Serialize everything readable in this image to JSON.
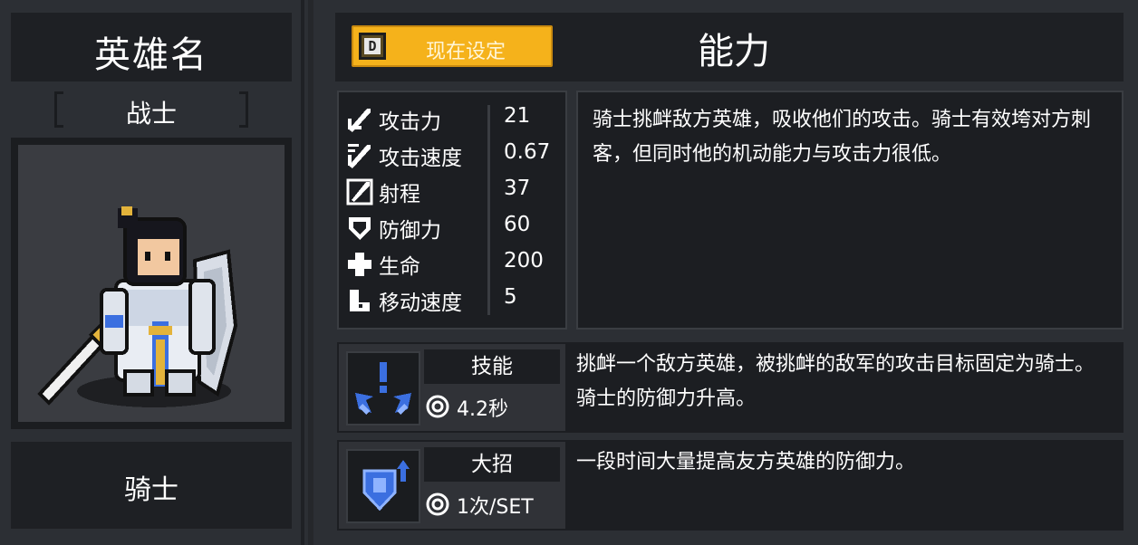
{
  "left": {
    "title": "英雄名",
    "class_label": "战士",
    "hero_name": "骑士"
  },
  "header": {
    "set_key": "D",
    "set_button": "现在设定",
    "title": "能力"
  },
  "stats": [
    {
      "icon": "sword-icon",
      "name": "攻击力",
      "value": "21"
    },
    {
      "icon": "attack-speed-icon",
      "name": "攻击速度",
      "value": "0.67"
    },
    {
      "icon": "range-icon",
      "name": "射程",
      "value": "37"
    },
    {
      "icon": "shield-icon",
      "name": "防御力",
      "value": "60"
    },
    {
      "icon": "health-cross-icon",
      "name": "生命",
      "value": "200"
    },
    {
      "icon": "boot-icon",
      "name": "移动速度",
      "value": "5"
    }
  ],
  "description": "骑士挑衅敌方英雄，吸收他们的攻击。骑士有效垮对方刺客，但同时他的机动能力与攻击力很低。",
  "skill": {
    "type": "技能",
    "cooldown": "4.2秒",
    "icon": "taunt-icon",
    "description": "挑衅一个敌方英雄，被挑衅的敌军的攻击目标固定为骑士。骑士的防御力升高。"
  },
  "ultimate": {
    "type": "大招",
    "cooldown": "1次/SET",
    "icon": "shield-up-icon",
    "description": "一段时间大量提高友方英雄的防御力。"
  },
  "colors": {
    "background": "#2c2f34",
    "panel_dark": "#1c1e22",
    "accent_yellow": "#f5b21b",
    "skill_blue": "#3b6fe0"
  }
}
